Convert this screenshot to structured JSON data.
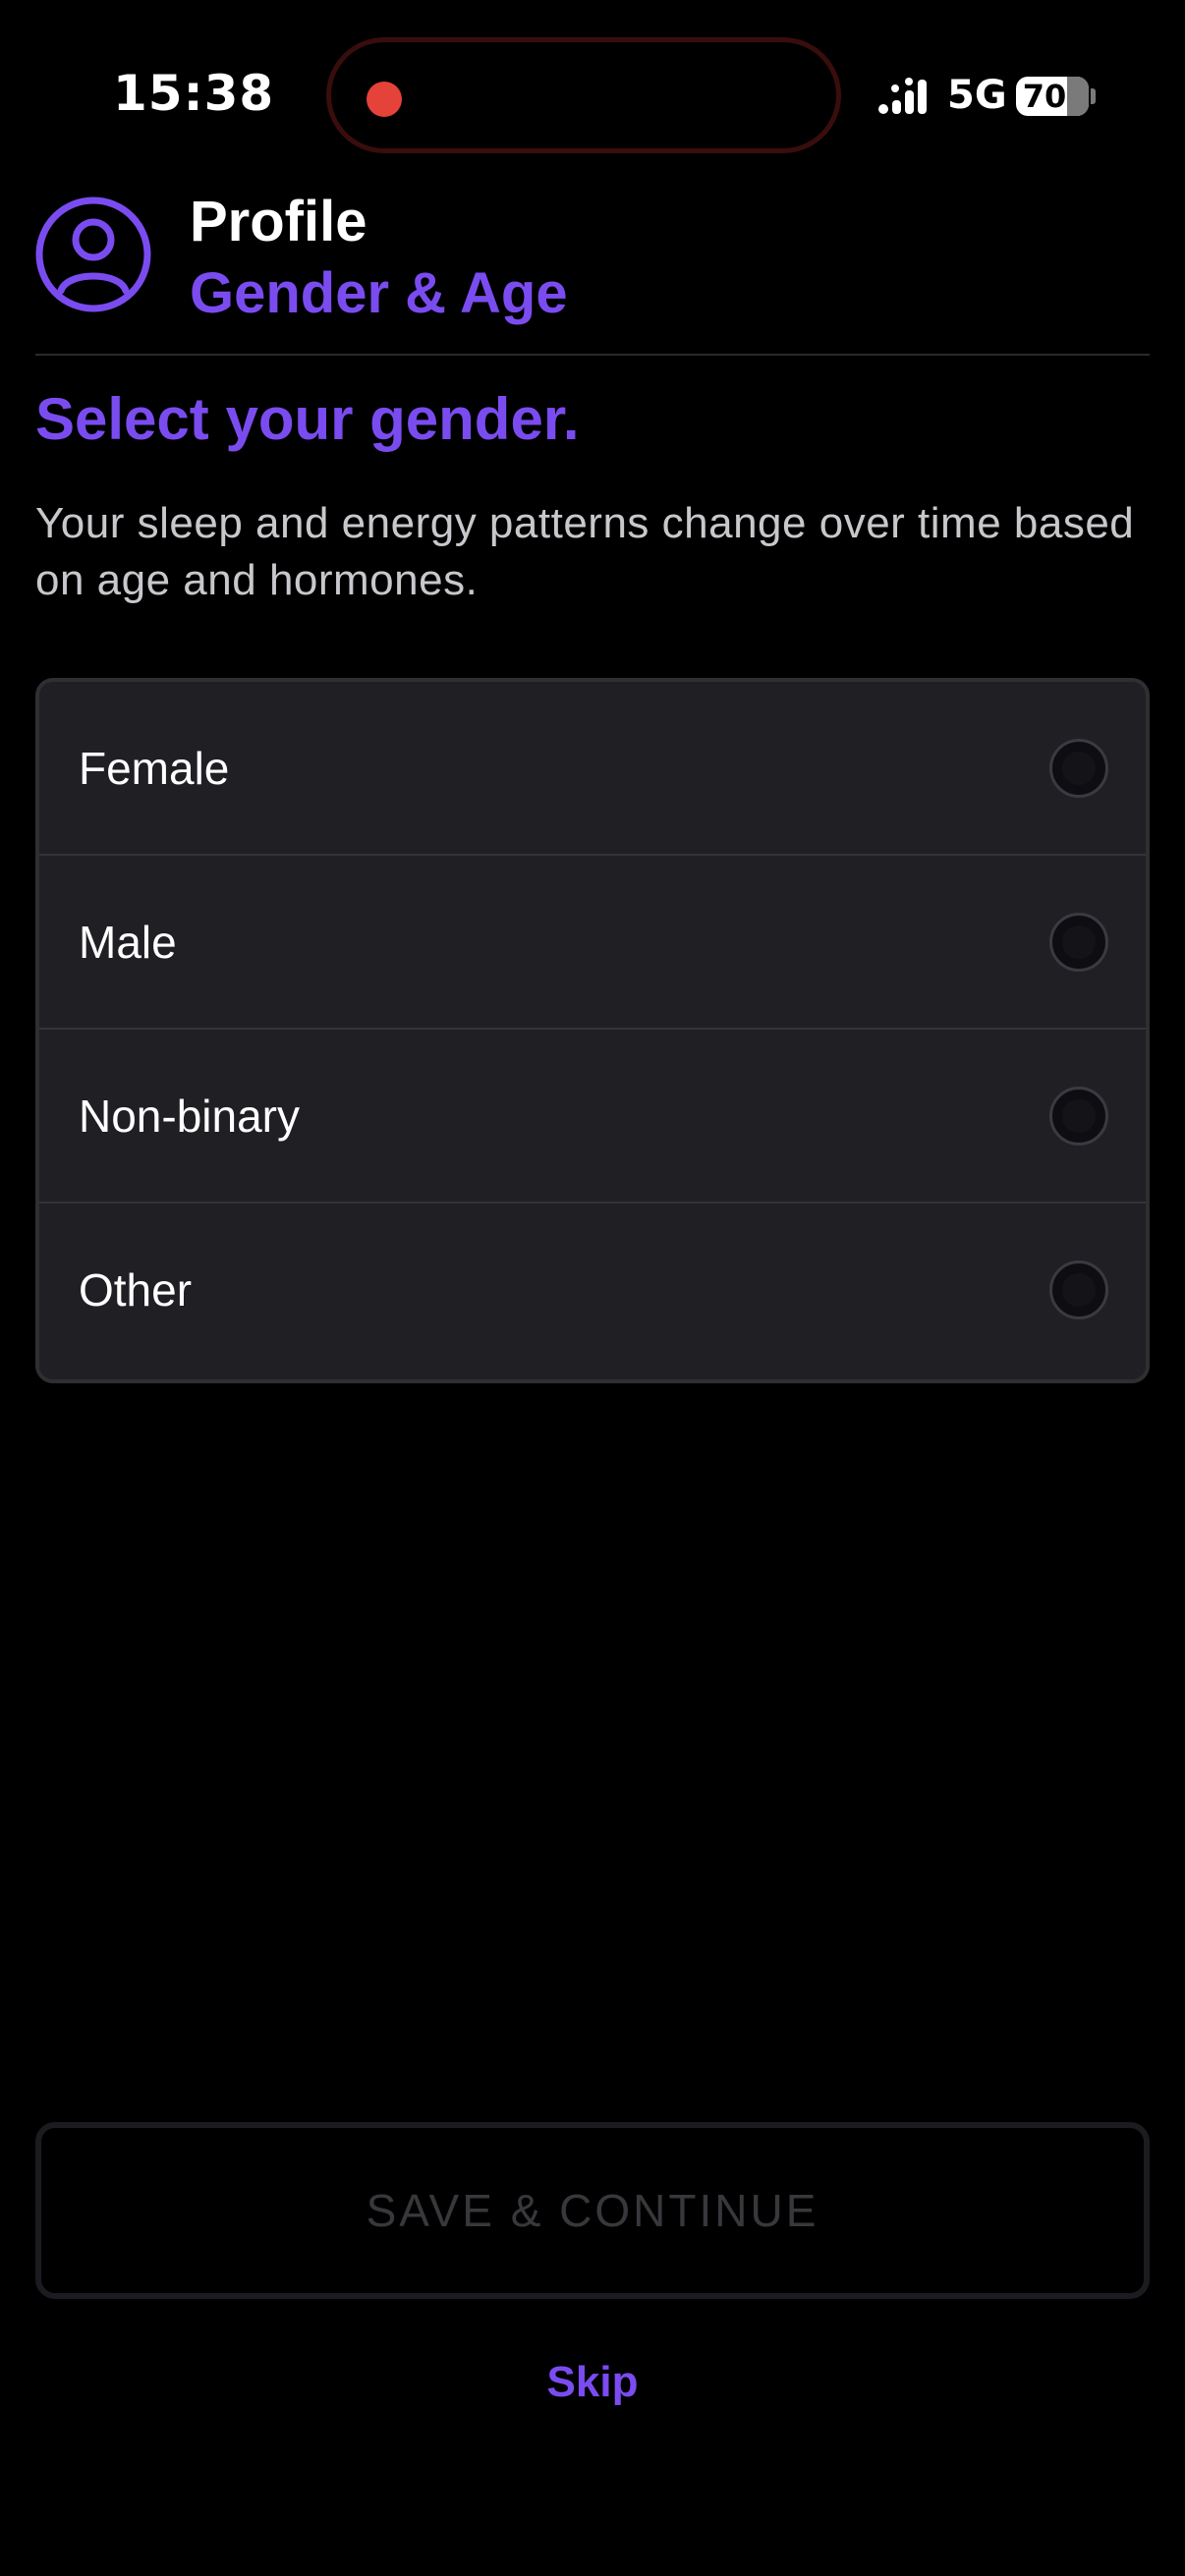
{
  "status_bar": {
    "time": "15:38",
    "network": "5G",
    "battery_level": "70",
    "battery_fraction": 0.7
  },
  "header": {
    "icon": "user-profile-icon",
    "title": "Profile",
    "subtitle": "Gender & Age"
  },
  "question": "Select your gender.",
  "description": "Your sleep and energy patterns change over time based on age and hormones.",
  "options": [
    {
      "label": "Female",
      "selected": false
    },
    {
      "label": "Male",
      "selected": false
    },
    {
      "label": "Non-binary",
      "selected": false
    },
    {
      "label": "Other",
      "selected": false
    }
  ],
  "actions": {
    "save_label": "SAVE & CONTINUE",
    "save_enabled": false,
    "skip_label": "Skip"
  },
  "colors": {
    "accent": "#7a4cf0",
    "background": "#000000",
    "card": "#1f1f24",
    "recording": "#e5423a"
  }
}
